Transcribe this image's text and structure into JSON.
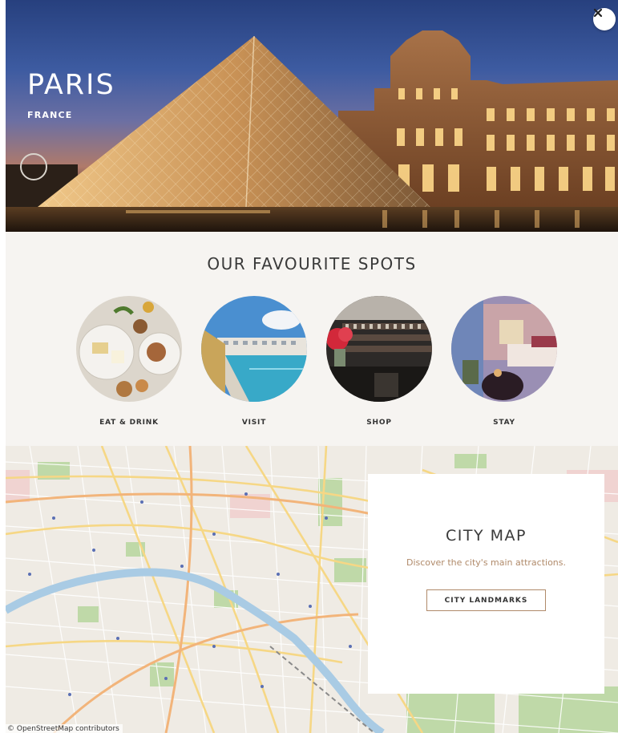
{
  "hero": {
    "city": "PARIS",
    "country": "FRANCE",
    "close_icon": "close-icon"
  },
  "spots": {
    "title": "OUR FAVOURITE SPOTS",
    "items": [
      {
        "label": "EAT & DRINK",
        "image": "food-plates-photo"
      },
      {
        "label": "VISIT",
        "image": "pool-building-photo"
      },
      {
        "label": "SHOP",
        "image": "shop-interior-photo"
      },
      {
        "label": "STAY",
        "image": "hotel-room-photo"
      }
    ]
  },
  "map": {
    "attribution": "© OpenStreetMap contributors",
    "card": {
      "title": "CITY MAP",
      "description": "Discover the city's main attractions.",
      "button_label": "CITY LANDMARKS"
    }
  },
  "colors": {
    "accent": "#b08a6a",
    "heading": "#3a3a3a",
    "section_bg": "#f6f4f1"
  }
}
